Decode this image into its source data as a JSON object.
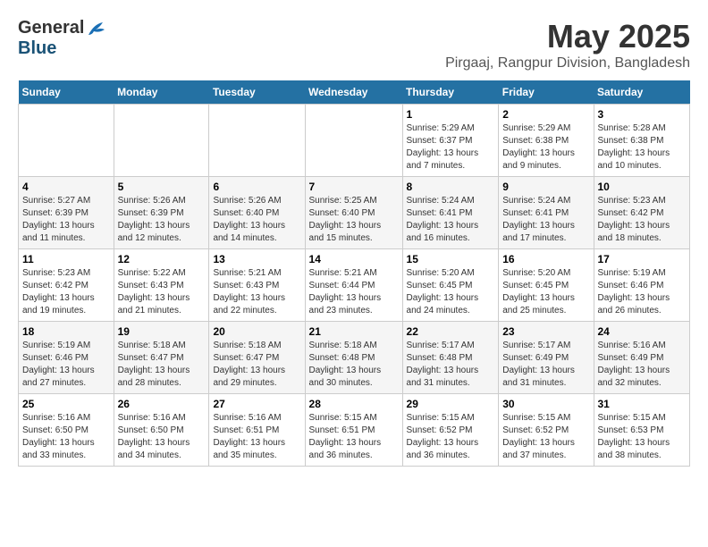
{
  "logo": {
    "general": "General",
    "blue": "Blue"
  },
  "title": {
    "month": "May 2025",
    "location": "Pirgaaj, Rangpur Division, Bangladesh"
  },
  "headers": [
    "Sunday",
    "Monday",
    "Tuesday",
    "Wednesday",
    "Thursday",
    "Friday",
    "Saturday"
  ],
  "weeks": [
    [
      {
        "day": "",
        "info": ""
      },
      {
        "day": "",
        "info": ""
      },
      {
        "day": "",
        "info": ""
      },
      {
        "day": "",
        "info": ""
      },
      {
        "day": "1",
        "info": "Sunrise: 5:29 AM\nSunset: 6:37 PM\nDaylight: 13 hours\nand 7 minutes."
      },
      {
        "day": "2",
        "info": "Sunrise: 5:29 AM\nSunset: 6:38 PM\nDaylight: 13 hours\nand 9 minutes."
      },
      {
        "day": "3",
        "info": "Sunrise: 5:28 AM\nSunset: 6:38 PM\nDaylight: 13 hours\nand 10 minutes."
      }
    ],
    [
      {
        "day": "4",
        "info": "Sunrise: 5:27 AM\nSunset: 6:39 PM\nDaylight: 13 hours\nand 11 minutes."
      },
      {
        "day": "5",
        "info": "Sunrise: 5:26 AM\nSunset: 6:39 PM\nDaylight: 13 hours\nand 12 minutes."
      },
      {
        "day": "6",
        "info": "Sunrise: 5:26 AM\nSunset: 6:40 PM\nDaylight: 13 hours\nand 14 minutes."
      },
      {
        "day": "7",
        "info": "Sunrise: 5:25 AM\nSunset: 6:40 PM\nDaylight: 13 hours\nand 15 minutes."
      },
      {
        "day": "8",
        "info": "Sunrise: 5:24 AM\nSunset: 6:41 PM\nDaylight: 13 hours\nand 16 minutes."
      },
      {
        "day": "9",
        "info": "Sunrise: 5:24 AM\nSunset: 6:41 PM\nDaylight: 13 hours\nand 17 minutes."
      },
      {
        "day": "10",
        "info": "Sunrise: 5:23 AM\nSunset: 6:42 PM\nDaylight: 13 hours\nand 18 minutes."
      }
    ],
    [
      {
        "day": "11",
        "info": "Sunrise: 5:23 AM\nSunset: 6:42 PM\nDaylight: 13 hours\nand 19 minutes."
      },
      {
        "day": "12",
        "info": "Sunrise: 5:22 AM\nSunset: 6:43 PM\nDaylight: 13 hours\nand 21 minutes."
      },
      {
        "day": "13",
        "info": "Sunrise: 5:21 AM\nSunset: 6:43 PM\nDaylight: 13 hours\nand 22 minutes."
      },
      {
        "day": "14",
        "info": "Sunrise: 5:21 AM\nSunset: 6:44 PM\nDaylight: 13 hours\nand 23 minutes."
      },
      {
        "day": "15",
        "info": "Sunrise: 5:20 AM\nSunset: 6:45 PM\nDaylight: 13 hours\nand 24 minutes."
      },
      {
        "day": "16",
        "info": "Sunrise: 5:20 AM\nSunset: 6:45 PM\nDaylight: 13 hours\nand 25 minutes."
      },
      {
        "day": "17",
        "info": "Sunrise: 5:19 AM\nSunset: 6:46 PM\nDaylight: 13 hours\nand 26 minutes."
      }
    ],
    [
      {
        "day": "18",
        "info": "Sunrise: 5:19 AM\nSunset: 6:46 PM\nDaylight: 13 hours\nand 27 minutes."
      },
      {
        "day": "19",
        "info": "Sunrise: 5:18 AM\nSunset: 6:47 PM\nDaylight: 13 hours\nand 28 minutes."
      },
      {
        "day": "20",
        "info": "Sunrise: 5:18 AM\nSunset: 6:47 PM\nDaylight: 13 hours\nand 29 minutes."
      },
      {
        "day": "21",
        "info": "Sunrise: 5:18 AM\nSunset: 6:48 PM\nDaylight: 13 hours\nand 30 minutes."
      },
      {
        "day": "22",
        "info": "Sunrise: 5:17 AM\nSunset: 6:48 PM\nDaylight: 13 hours\nand 31 minutes."
      },
      {
        "day": "23",
        "info": "Sunrise: 5:17 AM\nSunset: 6:49 PM\nDaylight: 13 hours\nand 31 minutes."
      },
      {
        "day": "24",
        "info": "Sunrise: 5:16 AM\nSunset: 6:49 PM\nDaylight: 13 hours\nand 32 minutes."
      }
    ],
    [
      {
        "day": "25",
        "info": "Sunrise: 5:16 AM\nSunset: 6:50 PM\nDaylight: 13 hours\nand 33 minutes."
      },
      {
        "day": "26",
        "info": "Sunrise: 5:16 AM\nSunset: 6:50 PM\nDaylight: 13 hours\nand 34 minutes."
      },
      {
        "day": "27",
        "info": "Sunrise: 5:16 AM\nSunset: 6:51 PM\nDaylight: 13 hours\nand 35 minutes."
      },
      {
        "day": "28",
        "info": "Sunrise: 5:15 AM\nSunset: 6:51 PM\nDaylight: 13 hours\nand 36 minutes."
      },
      {
        "day": "29",
        "info": "Sunrise: 5:15 AM\nSunset: 6:52 PM\nDaylight: 13 hours\nand 36 minutes."
      },
      {
        "day": "30",
        "info": "Sunrise: 5:15 AM\nSunset: 6:52 PM\nDaylight: 13 hours\nand 37 minutes."
      },
      {
        "day": "31",
        "info": "Sunrise: 5:15 AM\nSunset: 6:53 PM\nDaylight: 13 hours\nand 38 minutes."
      }
    ]
  ]
}
